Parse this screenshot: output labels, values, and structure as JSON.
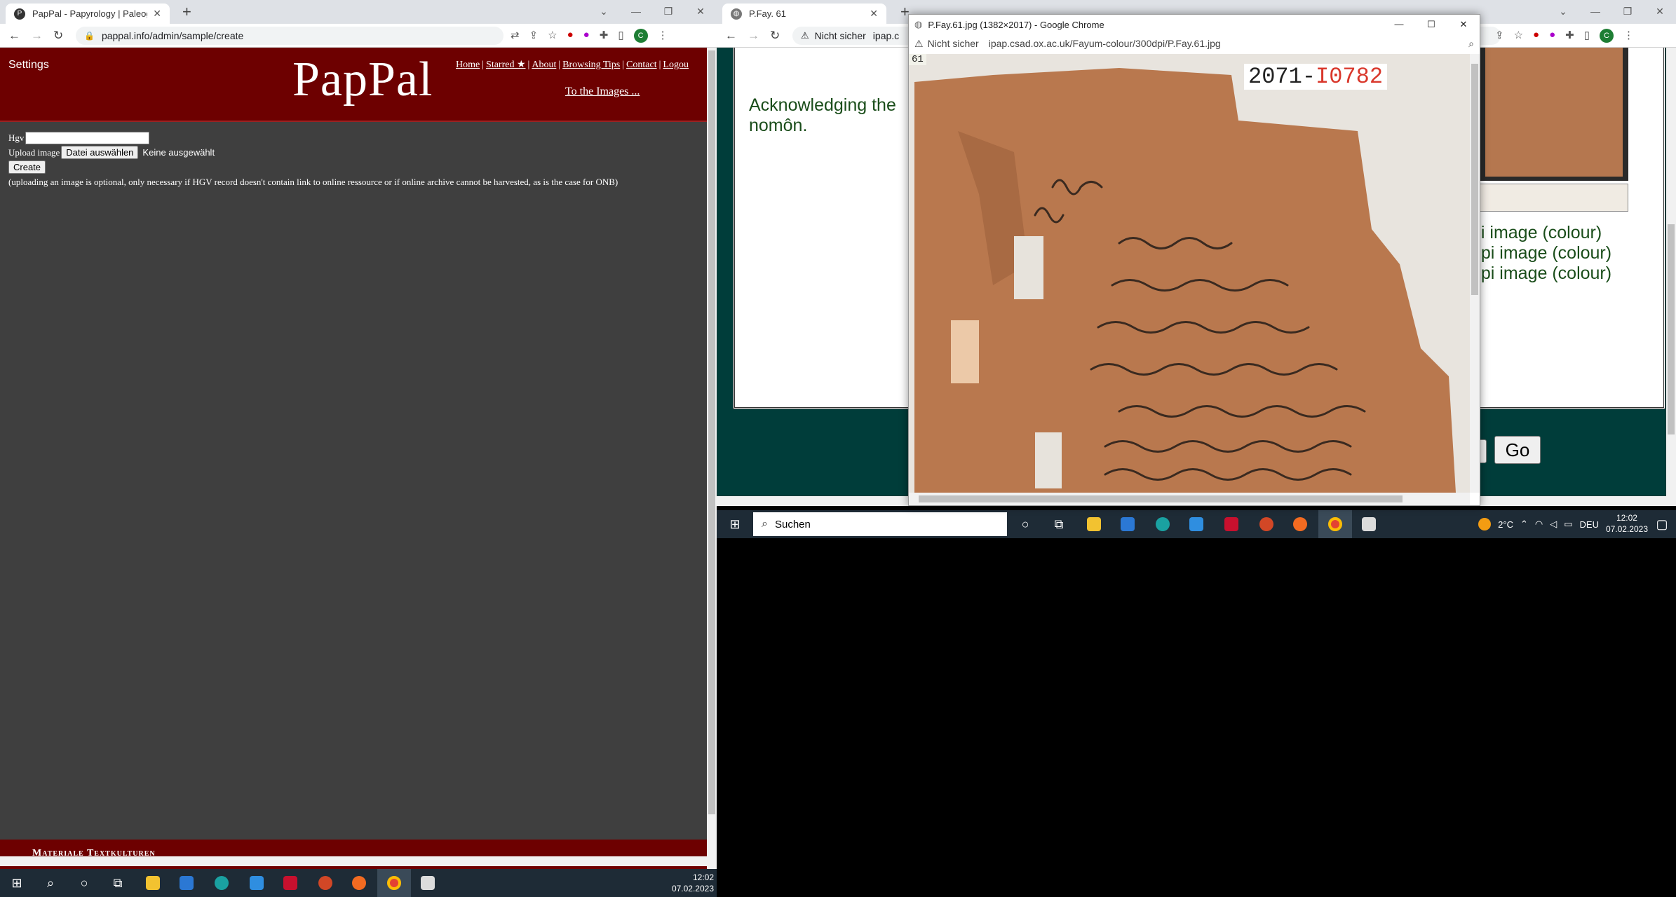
{
  "left_browser": {
    "tab_title": "PapPal - Papyrology | Paleograph",
    "url": "pappal.info/admin/sample/create",
    "profile_initial": "C"
  },
  "pappal": {
    "settings": "Settings",
    "logo": "PapPal",
    "nav": [
      "Home",
      "Starred ★",
      "About",
      "Browsing Tips",
      "Contact",
      "Logou"
    ],
    "to_images": "To the Images ...",
    "form": {
      "hgv_label": "Hgv",
      "upload_label": "Upload image",
      "file_button": "Datei auswählen",
      "file_status": "Keine ausgewählt",
      "create_button": "Create",
      "note": "(uploading an image is optional, only necessary if HGV record doesn't contain link to online ressource or if online archive cannot be harvested, as is the case for ONB)"
    },
    "footer": "Materiale Textkulturen"
  },
  "right_browser": {
    "tab_title": "P.Fay. 61",
    "security": "Nicht sicher",
    "url_partial": "ipap.c",
    "profile_initial": "C",
    "content": {
      "ack_line1": "Acknowledging the",
      "ack_line2": "nomôn.",
      "dpi_lines": [
        "pi image (colour)",
        "dpi image (colour)",
        "dpi image (colour)"
      ],
      "go_button": "Go"
    }
  },
  "popup": {
    "title": "P.Fay.61.jpg (1382×2017) - Google Chrome",
    "security": "Nicht sicher",
    "url": "ipap.csad.ox.ac.uk/Fayum-colour/300dpi/P.Fay.61.jpg",
    "inventory_black": "2071-",
    "inventory_red": "I0782",
    "corner_label": "61"
  },
  "taskbar_left": {
    "time": "12:02",
    "date": "07.02.2023"
  },
  "taskbar_right": {
    "search_placeholder": "Suchen",
    "temperature": "2°C",
    "language": "DEU",
    "time": "12:02",
    "date": "07.02.2023"
  }
}
